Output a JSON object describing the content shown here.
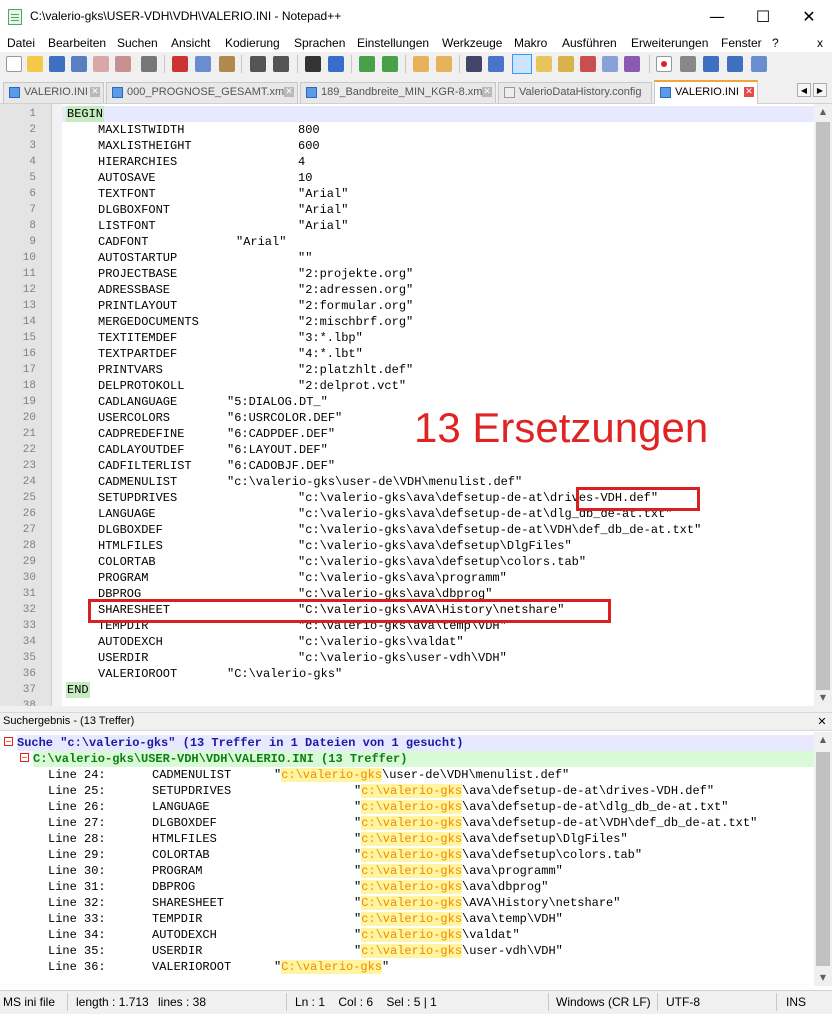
{
  "window": {
    "title": "C:\\valerio-gks\\USER-VDH\\VDH\\VALERIO.INI - Notepad++",
    "minimize": "—",
    "maximize": "☐",
    "close": "✕"
  },
  "menu": [
    "Datei",
    "Bearbeiten",
    "Suchen",
    "Ansicht",
    "Kodierung",
    "Sprachen",
    "Einstellungen",
    "Werkzeuge",
    "Makro",
    "Ausführen",
    "Erweiterungen",
    "Fenster",
    "?"
  ],
  "menu_close": "x",
  "tabs": [
    {
      "label": "VALERIO.INI",
      "active": false
    },
    {
      "label": "000_PROGNOSE_GESAMT.xml",
      "active": false
    },
    {
      "label": "189_Bandbreite_MIN_KGR-8.xml",
      "active": false
    },
    {
      "label": "ValerioDataHistory.config",
      "active": false
    },
    {
      "label": "VALERIO.INI",
      "active": true
    }
  ],
  "tab_close": "✕",
  "tab_nav": {
    "left": "◀",
    "right": "▶"
  },
  "editor": {
    "lines": [
      {
        "n": "1",
        "kw": "BEGIN"
      },
      {
        "n": "2",
        "k": "MAXLISTWIDTH",
        "v": "800"
      },
      {
        "n": "3",
        "k": "MAXLISTHEIGHT",
        "v": "600"
      },
      {
        "n": "4",
        "k": "HIERARCHIES",
        "v": "4"
      },
      {
        "n": "5",
        "k": "AUTOSAVE",
        "v": "10"
      },
      {
        "n": "6",
        "k": "TEXTFONT",
        "v": "\"Arial\""
      },
      {
        "n": "7",
        "k": "DLGBOXFONT",
        "v": "\"Arial\""
      },
      {
        "n": "8",
        "k": "LISTFONT",
        "v": "\"Arial\""
      },
      {
        "n": "9",
        "k": "CADFONT",
        "v": "\"Arial\"",
        "c": "b"
      },
      {
        "n": "10",
        "k": "AUTOSTARTUP",
        "v": "\"\""
      },
      {
        "n": "11",
        "k": "PROJECTBASE",
        "v": "\"2:projekte.org\""
      },
      {
        "n": "12",
        "k": "ADRESSBASE",
        "v": "\"2:adressen.org\""
      },
      {
        "n": "13",
        "k": "PRINTLAYOUT",
        "v": "\"2:formular.org\""
      },
      {
        "n": "14",
        "k": "MERGEDOCUMENTS",
        "v": "\"2:mischbrf.org\""
      },
      {
        "n": "15",
        "k": "TEXTITEMDEF",
        "v": "\"3:*.lbp\""
      },
      {
        "n": "16",
        "k": "TEXTPARTDEF",
        "v": "\"4:*.lbt\""
      },
      {
        "n": "17",
        "k": "PRINTVARS",
        "v": "\"2:platzhlt.def\""
      },
      {
        "n": "18",
        "k": "DELPROTOKOLL",
        "v": "\"2:delprot.vct\""
      },
      {
        "n": "19",
        "k": "CADLANGUAGE",
        "v": "\"5:DIALOG.DT_\"",
        "c": "c"
      },
      {
        "n": "20",
        "k": "USERCOLORS",
        "v": "\"6:USRCOLOR.DEF\"",
        "c": "c"
      },
      {
        "n": "21",
        "k": "CADPREDEFINE",
        "v": "\"6:CADPDEF.DEF\"",
        "c": "c"
      },
      {
        "n": "22",
        "k": "CADLAYOUTDEF",
        "v": "\"6:LAYOUT.DEF\"",
        "c": "c"
      },
      {
        "n": "23",
        "k": "CADFILTERLIST",
        "v": "\"6:CADOBJF.DEF\"",
        "c": "c"
      },
      {
        "n": "24",
        "k": "CADMENULIST",
        "v": "\"c:\\valerio-gks\\user-de\\VDH\\menulist.def\"",
        "c": "c"
      },
      {
        "n": "25",
        "k": "SETUPDRIVES",
        "v": "\"c:\\valerio-gks\\ava\\defsetup-de-at\\drives-VDH.def\""
      },
      {
        "n": "26",
        "k": "LANGUAGE",
        "v": "\"c:\\valerio-gks\\ava\\defsetup-de-at\\dlg_db_de-at.txt\""
      },
      {
        "n": "27",
        "k": "DLGBOXDEF",
        "v": "\"c:\\valerio-gks\\ava\\defsetup-de-at\\VDH\\def_db_de-at.txt\""
      },
      {
        "n": "28",
        "k": "HTMLFILES",
        "v": "\"c:\\valerio-gks\\ava\\defsetup\\DlgFiles\""
      },
      {
        "n": "29",
        "k": "COLORTAB",
        "v": "\"c:\\valerio-gks\\ava\\defsetup\\colors.tab\""
      },
      {
        "n": "30",
        "k": "PROGRAM",
        "v": "\"c:\\valerio-gks\\ava\\programm\""
      },
      {
        "n": "31",
        "k": "DBPROG",
        "v": "\"c:\\valerio-gks\\ava\\dbprog\""
      },
      {
        "n": "32",
        "k": "SHARESHEET",
        "v": "\"C:\\valerio-gks\\AVA\\History\\netshare\""
      },
      {
        "n": "33",
        "k": "TEMPDIR",
        "v": "\"c:\\valerio-gks\\ava\\temp\\VDH\""
      },
      {
        "n": "34",
        "k": "AUTODEXCH",
        "v": "\"c:\\valerio-gks\\valdat\""
      },
      {
        "n": "35",
        "k": "USERDIR",
        "v": "\"c:\\valerio-gks\\user-vdh\\VDH\""
      },
      {
        "n": "36",
        "k": "VALERIOROOT",
        "v": "\"C:\\valerio-gks\"",
        "c": "c"
      },
      {
        "n": "37",
        "kw": "END"
      },
      {
        "n": "38"
      }
    ]
  },
  "annotation": "13 Ersetzungen",
  "search": {
    "panel_title": "Suchergebnis - (13 Treffer)",
    "close": "✕",
    "summary": "Suche \"c:\\valerio-gks\" (13 Treffer in 1 Dateien von 1 gesucht)",
    "file": "C:\\valerio-gks\\USER-VDH\\VDH\\VALERIO.INI (13 Treffer)",
    "results": [
      {
        "line": "Line 24:",
        "key": "CADMENULIST",
        "q": "\"",
        "hit": "c:\\valerio-gks",
        "rest": "\\user-de\\VDH\\menulist.def\"",
        "c": "c"
      },
      {
        "line": "Line 25:",
        "key": "SETUPDRIVES",
        "q": "\"",
        "hit": "c:\\valerio-gks",
        "rest": "\\ava\\defsetup-de-at\\drives-VDH.def\""
      },
      {
        "line": "Line 26:",
        "key": "LANGUAGE",
        "q": "\"",
        "hit": "c:\\valerio-gks",
        "rest": "\\ava\\defsetup-de-at\\dlg_db_de-at.txt\""
      },
      {
        "line": "Line 27:",
        "key": "DLGBOXDEF",
        "q": "\"",
        "hit": "c:\\valerio-gks",
        "rest": "\\ava\\defsetup-de-at\\VDH\\def_db_de-at.txt\""
      },
      {
        "line": "Line 28:",
        "key": "HTMLFILES",
        "q": "\"",
        "hit": "c:\\valerio-gks",
        "rest": "\\ava\\defsetup\\DlgFiles\""
      },
      {
        "line": "Line 29:",
        "key": "COLORTAB",
        "q": "\"",
        "hit": "c:\\valerio-gks",
        "rest": "\\ava\\defsetup\\colors.tab\""
      },
      {
        "line": "Line 30:",
        "key": "PROGRAM",
        "q": "\"",
        "hit": "c:\\valerio-gks",
        "rest": "\\ava\\programm\""
      },
      {
        "line": "Line 31:",
        "key": "DBPROG",
        "q": "\"",
        "hit": "c:\\valerio-gks",
        "rest": "\\ava\\dbprog\""
      },
      {
        "line": "Line 32:",
        "key": "SHARESHEET",
        "q": "\"",
        "hit": "C:\\valerio-gks",
        "rest": "\\AVA\\History\\netshare\""
      },
      {
        "line": "Line 33:",
        "key": "TEMPDIR",
        "q": "\"",
        "hit": "c:\\valerio-gks",
        "rest": "\\ava\\temp\\VDH\""
      },
      {
        "line": "Line 34:",
        "key": "AUTODEXCH",
        "q": "\"",
        "hit": "c:\\valerio-gks",
        "rest": "\\valdat\""
      },
      {
        "line": "Line 35:",
        "key": "USERDIR",
        "q": "\"",
        "hit": "c:\\valerio-gks",
        "rest": "\\user-vdh\\VDH\""
      },
      {
        "line": "Line 36:",
        "key": "VALERIOROOT",
        "q": "\"",
        "hit": "C:\\valerio-gks",
        "rest": "\"",
        "c": "b"
      }
    ]
  },
  "status": {
    "filetype": "MS ini file",
    "length": "length : 1.713",
    "lines": "lines : 38",
    "position": "Ln : 1    Col : 6    Sel : 5 | 1",
    "eol": "Windows (CR LF)",
    "encoding": "UTF-8",
    "mode": "INS"
  },
  "colors": {
    "accent": "#f2a33a",
    "annotation": "#e02424",
    "keyword_bg": "#c5ebc0",
    "hit": "#f08a00",
    "result_summary": "#1a1aa6",
    "result_file": "#0b7f12"
  }
}
